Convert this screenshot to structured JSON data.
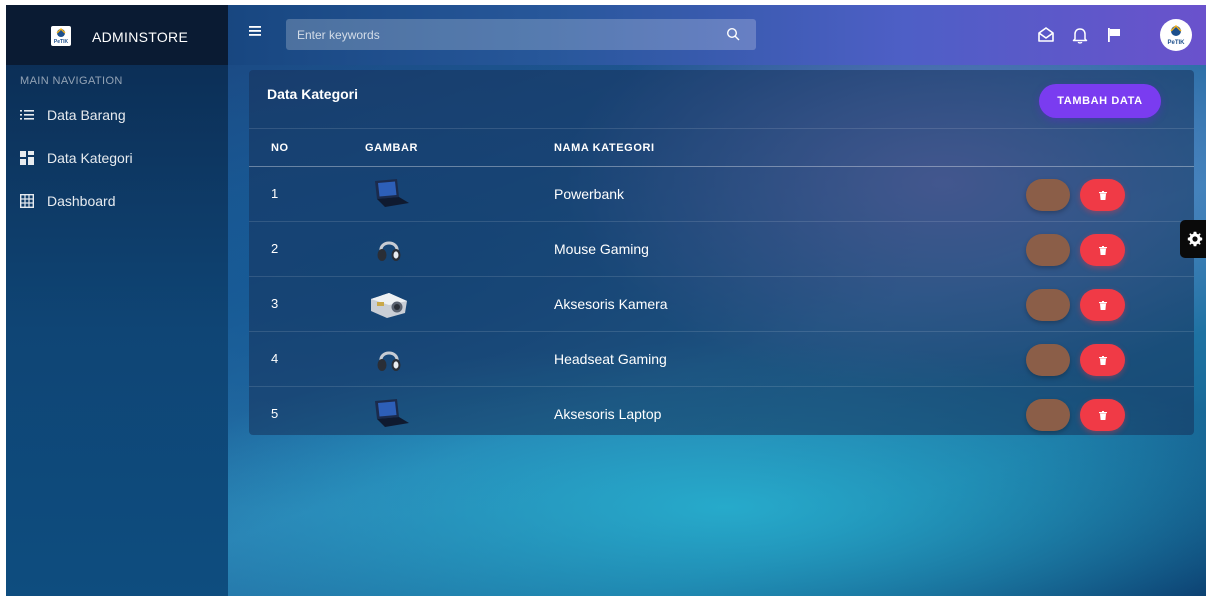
{
  "app": {
    "title": "ADMINSTORE",
    "logo_text": "PeTIK"
  },
  "header": {
    "search_placeholder": "Enter keywords",
    "icons": [
      "menu-icon",
      "search-icon",
      "envelope-icon",
      "bell-icon",
      "flag-icon"
    ],
    "avatar_text": "PeTIK"
  },
  "sidebar": {
    "heading": "MAIN NAVIGATION",
    "items": [
      {
        "label": "Data Barang",
        "icon": "list-icon"
      },
      {
        "label": "Data Kategori",
        "icon": "grid-icon"
      },
      {
        "label": "Dashboard",
        "icon": "table-icon"
      }
    ]
  },
  "card": {
    "title": "Data Kategori",
    "add_button": "TAMBAH DATA",
    "columns": [
      "NO",
      "GAMBAR",
      "NAMA KATEGORI"
    ],
    "rows": [
      {
        "no": "1",
        "image": "laptop",
        "name": "Powerbank"
      },
      {
        "no": "2",
        "image": "headphones",
        "name": "Mouse Gaming"
      },
      {
        "no": "3",
        "image": "camera",
        "name": "Aksesoris Kamera"
      },
      {
        "no": "4",
        "image": "headphones",
        "name": "Headseat Gaming"
      },
      {
        "no": "5",
        "image": "laptop",
        "name": "Aksesoris Laptop"
      }
    ]
  },
  "colors": {
    "accent": "#7a3cf0",
    "edit": "#8b5e48",
    "delete": "#f03a46",
    "sidebar": "#0c2f57"
  }
}
